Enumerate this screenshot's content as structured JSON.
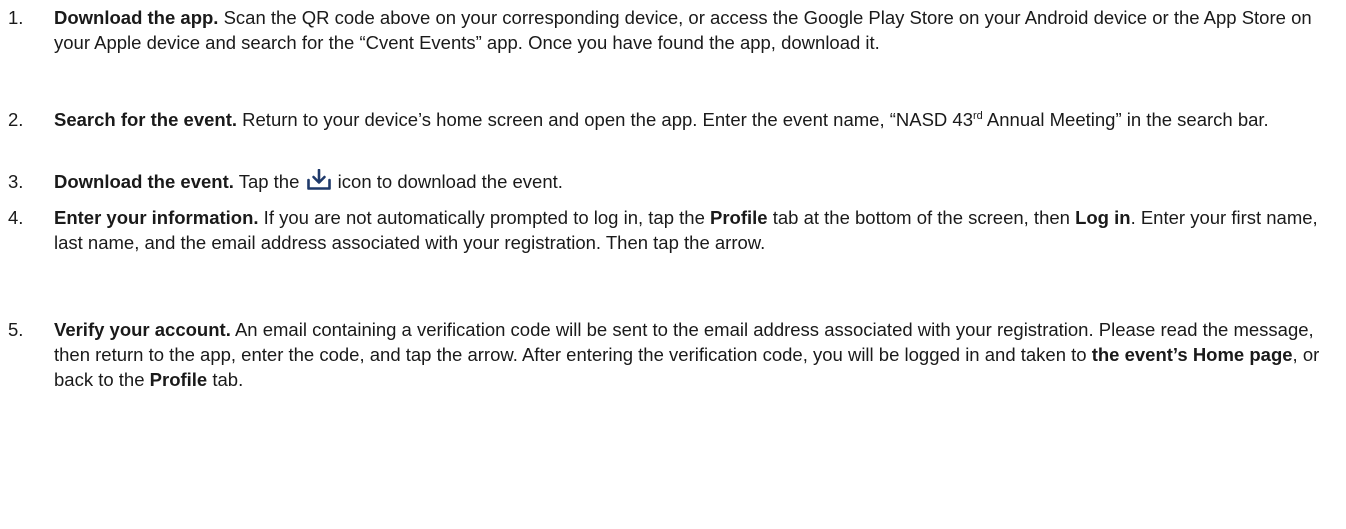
{
  "steps": [
    {
      "number": "1.",
      "lead": "Download the app.",
      "text": " Scan the QR code above on your corresponding device, or access the Google Play Store on your Android device or the App Store on your Apple device and search for the “Cvent Events” app. Once you have found the app, download it."
    },
    {
      "number": "2.",
      "lead": "Search for the event.",
      "text_a": " Return to your device’s home screen and open the app. Enter the event name, “NASD 43",
      "sup": "rd",
      "text_b": " Annual Meeting” in the search bar."
    },
    {
      "number": "3.",
      "lead": "Download the event.",
      "text_a": " Tap the ",
      "icon": "download-tray-icon",
      "text_b": " icon to download the event."
    },
    {
      "number": "4.",
      "lead": "Enter your information.",
      "text_a": " If you are not automatically prompted to log in, tap the ",
      "bold_a": "Profile",
      "text_b": " tab at the bottom of the screen, then ",
      "bold_b": "Log in",
      "text_c": ". Enter your first name, last name, and the email address associated with your registration. Then tap the arrow."
    },
    {
      "number": "5.",
      "lead": "Verify your account.",
      "text_a": " An email containing a verification code will be sent to the email address associated with your registration. Please read the message, then return to the app, enter the code, and tap the arrow. After entering the verification code, you will be logged in and taken to ",
      "bold_a": "the event’s Home page",
      "text_b": ", or back to the ",
      "bold_b": "Profile",
      "text_c": " tab."
    }
  ],
  "colors": {
    "text": "#1a1a1a",
    "icon": "#1f3a6b"
  }
}
